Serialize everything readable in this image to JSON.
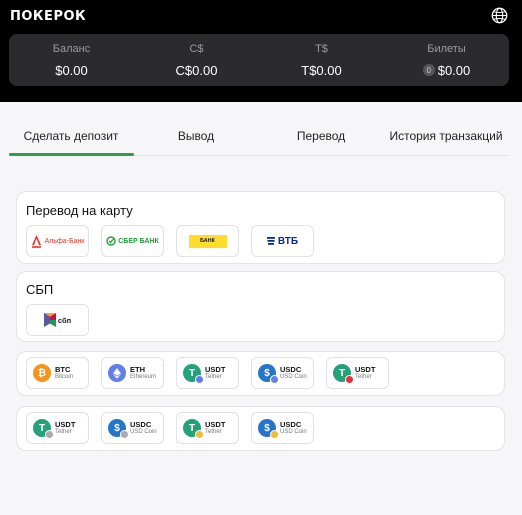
{
  "header": {
    "logo": "ПОКЕРОК",
    "globe_icon": "globe-icon"
  },
  "balance": [
    {
      "label": "Баланс",
      "value": "$0.00"
    },
    {
      "label": "C$",
      "value": "C$0.00"
    },
    {
      "label": "T$",
      "value": "T$0.00"
    },
    {
      "label": "Билеты",
      "value": "$0.00",
      "badge": "0"
    }
  ],
  "tabs": [
    {
      "label": "Сделать депозит",
      "active": true
    },
    {
      "label": "Вывод"
    },
    {
      "label": "Перевод"
    },
    {
      "label": "История транзакций"
    }
  ],
  "sections": {
    "card_transfer": {
      "title": "Перевод на карту",
      "banks": [
        "Альфа-Банк",
        "СБЕР БАНК",
        "БАНК",
        "ВТБ"
      ]
    },
    "sbp": {
      "title": "СБП",
      "logo_text": "сбп"
    },
    "crypto_row1": [
      {
        "name": "BTC",
        "sub": "Bitcoin"
      },
      {
        "name": "ETH",
        "sub": "Ethereum"
      },
      {
        "name": "USDT",
        "sub": "Tether"
      },
      {
        "name": "USDC",
        "sub": "USD Coin"
      },
      {
        "name": "USDT",
        "sub": "Tether"
      }
    ],
    "crypto_row2": [
      {
        "name": "USDT",
        "sub": "Tether"
      },
      {
        "name": "USDC",
        "sub": "USD Coin"
      },
      {
        "name": "USDT",
        "sub": "Tether"
      },
      {
        "name": "USDC",
        "sub": "USD Coin"
      }
    ]
  },
  "colors": {
    "accent_green": "#2e9e4a",
    "btc": "#f7931a",
    "eth": "#627eea",
    "usdt": "#26a17b",
    "usdc": "#2775ca",
    "alfa_red": "#ef3124",
    "sber_green": "#21a038",
    "vtb_blue": "#0a2896",
    "tbank_yellow": "#ffdd2d"
  }
}
